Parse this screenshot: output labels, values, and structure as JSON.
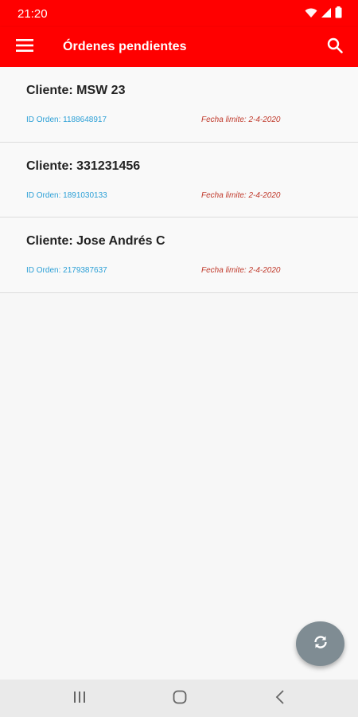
{
  "status_bar": {
    "time": "21:20",
    "icons": [
      "wifi-icon",
      "signal-icon",
      "battery-icon"
    ]
  },
  "app_bar": {
    "title": "Órdenes pendientes",
    "menu_icon": "menu-icon",
    "search_icon": "search-icon"
  },
  "orders": [
    {
      "client": "Cliente: MSW 23",
      "id": "ID Orden: 1188648917",
      "deadline": "Fecha limite: 2-4-2020"
    },
    {
      "client": "Cliente: 331231456",
      "id": "ID Orden: 1891030133",
      "deadline": "Fecha limite: 2-4-2020"
    },
    {
      "client": "Cliente: Jose Andrés C",
      "id": "ID Orden: 2179387637",
      "deadline": "Fecha limite: 2-4-2020"
    }
  ],
  "fab": {
    "icon": "refresh-icon"
  },
  "nav_bar": {
    "icons": [
      "recent-apps-icon",
      "home-icon",
      "back-icon"
    ]
  },
  "colors": {
    "primary": "#ff0000",
    "order_id": "#2a9fd6",
    "deadline": "#c0392b",
    "fab": "#7f8c93"
  }
}
